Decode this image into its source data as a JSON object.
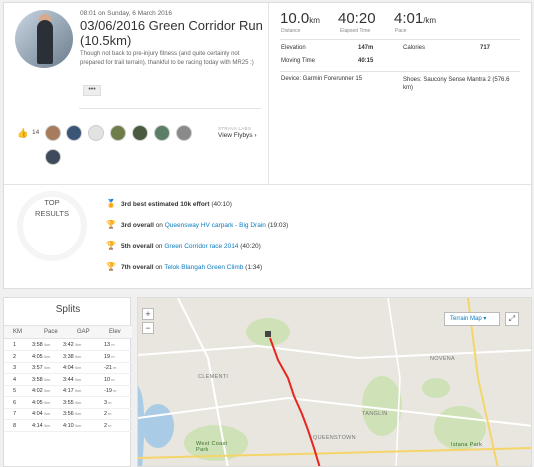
{
  "activity": {
    "datetime": "08:01 on Sunday, 6 March 2016",
    "title": "03/06/2016 Green Corridor Run (10.5km)",
    "description": "Though not back to pre-injury fitness (and quite certainly not prepared for trail terrain), thankful to be racing today with MR25 :)",
    "more_label": "•••",
    "kudos_count": "14",
    "flybys_small": "STRAVA LABS",
    "flybys_label": "View Flybys ›"
  },
  "stats": {
    "distance": {
      "value": "10.0",
      "unit": "km",
      "label": "Distance"
    },
    "elapsed": {
      "value": "40:20",
      "unit": "",
      "label": "Elapsed Time"
    },
    "pace": {
      "value": "4:01",
      "unit": "/km",
      "label": "Pace"
    },
    "elevation_label": "Elevation",
    "elevation_value": "147m",
    "calories_label": "Calories",
    "calories_value": "717",
    "moving_label": "Moving Time",
    "moving_value": "40:15",
    "device": "Device: Garmin Forerunner 15",
    "shoes": "Shoes: Saucony Sense Mantra 2 (576.6 km)"
  },
  "results": {
    "heading": "TOP RESULTS",
    "items": [
      {
        "bold": "3rd best estimated 10k effort",
        "pre": "",
        "link": "",
        "post": " (40:10)"
      },
      {
        "bold": "3rd overall",
        "pre": " on ",
        "link": "Queensway HV carpark - Big Drain",
        "post": " (19:03)"
      },
      {
        "bold": "5th overall",
        "pre": " on ",
        "link": "Green Corridor race 2014",
        "post": " (40:20)"
      },
      {
        "bold": "7th overall",
        "pre": " on ",
        "link": "Telok Blangah Green Climb",
        "post": " (1:34)"
      }
    ]
  },
  "splits": {
    "title": "Splits",
    "headers": [
      "KM",
      "Pace",
      "GAP",
      "Elev"
    ],
    "rows": [
      [
        "1",
        "3:58",
        "3:42",
        "13"
      ],
      [
        "2",
        "4:05",
        "3:38",
        "19"
      ],
      [
        "3",
        "3:57",
        "4:04",
        "-21"
      ],
      [
        "4",
        "3:58",
        "3:44",
        "10"
      ],
      [
        "5",
        "4:02",
        "4:17",
        "-19"
      ],
      [
        "6",
        "4:05",
        "3:55",
        "3"
      ],
      [
        "7",
        "4:04",
        "3:56",
        "2"
      ],
      [
        "8",
        "4:14",
        "4:10",
        "2"
      ]
    ],
    "pace_unit": "/km",
    "elev_unit": "m"
  },
  "map": {
    "zoom_in": "+",
    "zoom_out": "−",
    "terrain_label": "Terrain Map ▾",
    "fullscreen": "⤢",
    "labels": {
      "clementi": "CLEMENTI",
      "novena": "NOVENA",
      "tanglin": "TANGLIN",
      "queenstown": "QUEENSTOWN",
      "west_coast": "West Coast Park",
      "istana": "Istana Park"
    },
    "route_color": "#e8251e"
  }
}
